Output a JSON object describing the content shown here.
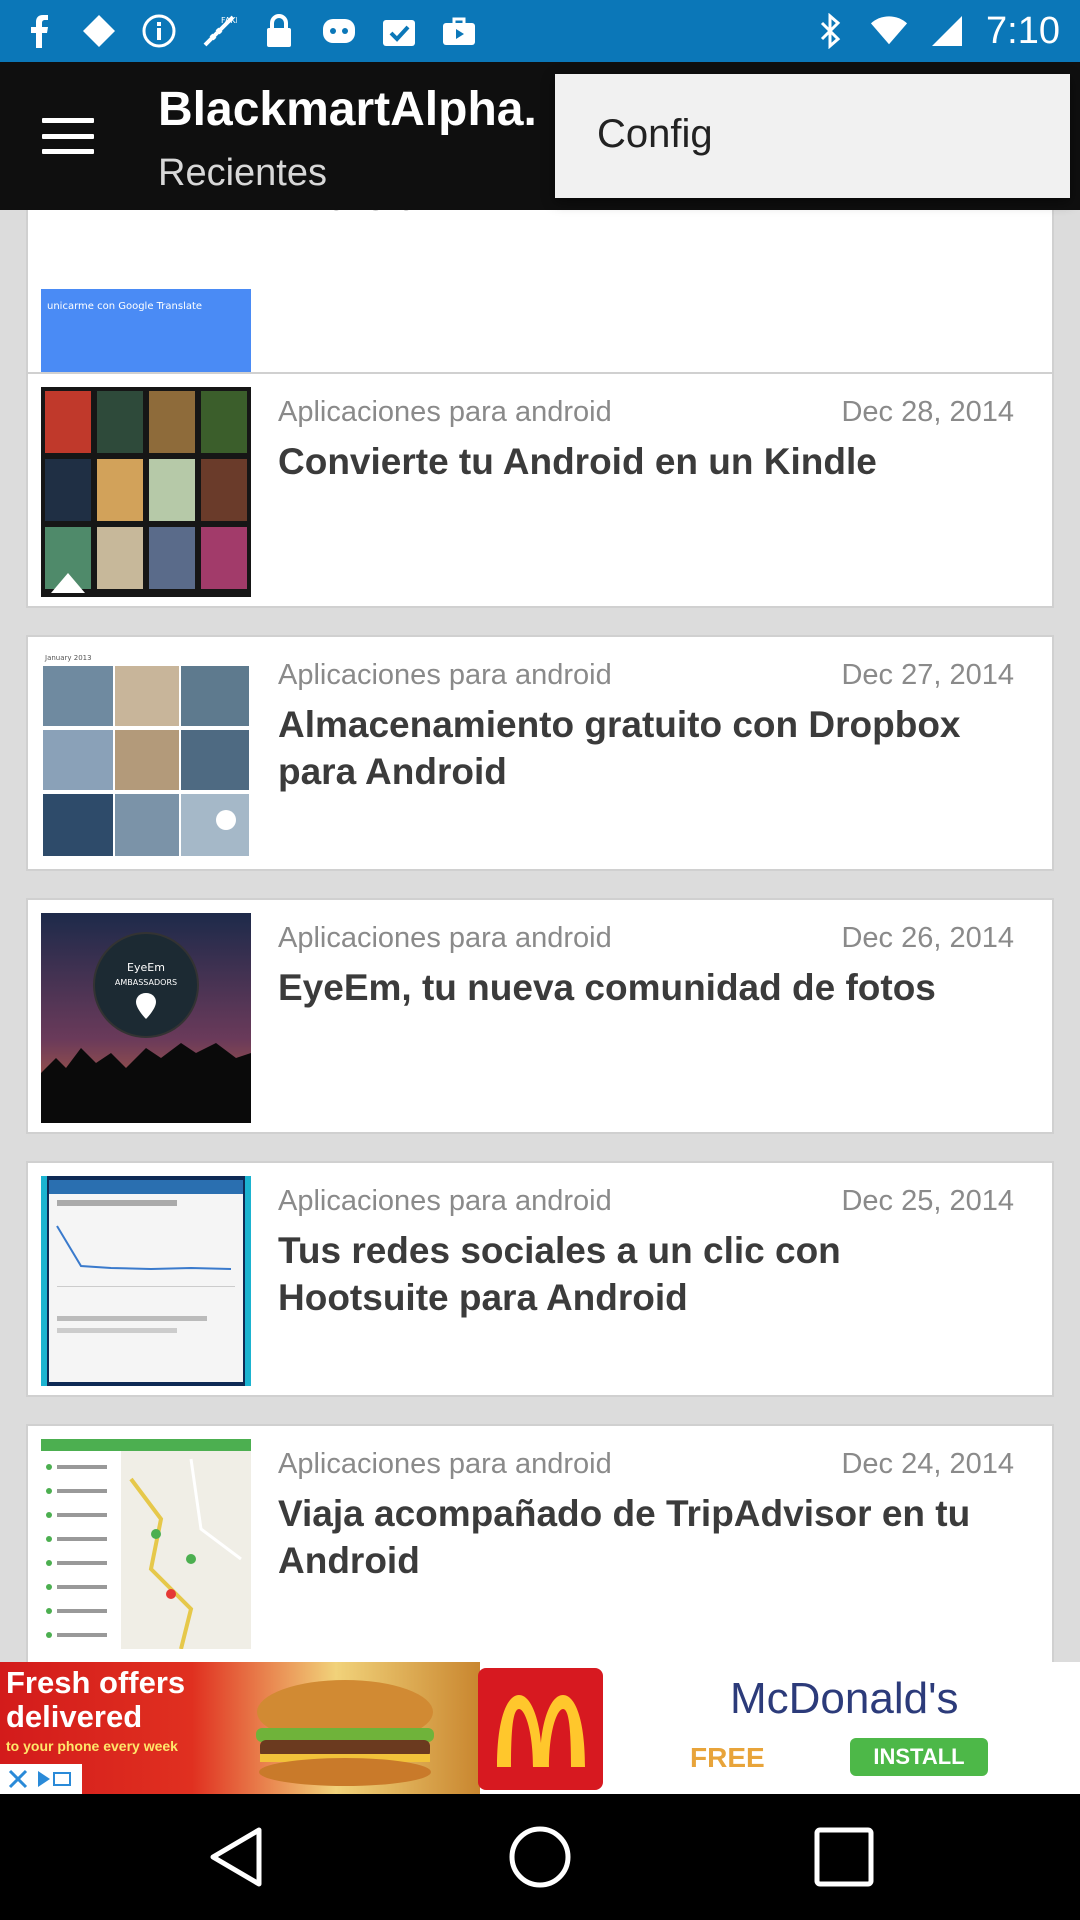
{
  "status_bar": {
    "time": "7:10",
    "icons": [
      "facebook-icon",
      "diamond-icon",
      "info-icon",
      "fake-gps-icon",
      "lock-icon",
      "notification-icon",
      "tasks-icon",
      "briefcase-icon",
      "bluetooth-icon",
      "wifi-icon",
      "signal-icon"
    ]
  },
  "app_bar": {
    "title": "BlackmartAlpha.",
    "subtitle": "Recientes"
  },
  "popup_menu": {
    "items": [
      {
        "label": "Config"
      }
    ]
  },
  "articles": [
    {
      "category": "",
      "date": "",
      "title": "Android"
    },
    {
      "category": "Aplicaciones para android",
      "date": "Dec 28, 2014",
      "title": "Convierte tu Android en un Kindle"
    },
    {
      "category": "Aplicaciones para android",
      "date": "Dec 27, 2014",
      "title": "Almacenamiento gratuito con Dropbox para Android"
    },
    {
      "category": "Aplicaciones para android",
      "date": "Dec 26, 2014",
      "title": "EyeEm, tu nueva comunidad de fotos"
    },
    {
      "category": "Aplicaciones para android",
      "date": "Dec 25, 2014",
      "title": "Tus redes sociales a un clic con Hootsuite para Android"
    },
    {
      "category": "Aplicaciones para android",
      "date": "Dec 24, 2014",
      "title": "Viaja acompañado de TripAdvisor en tu Android"
    }
  ],
  "thumbnails": {
    "translate_caption": "unicarme con Google Translate",
    "eyeem_caption_1": "EyeEm",
    "eyeem_caption_2": "AMBASSADORS",
    "dropbox_caption": "January 2013"
  },
  "ad": {
    "headline": "Fresh offers delivered",
    "sub": "to your phone every week",
    "brand": "McDonald's",
    "free_label": "FREE",
    "install_label": "INSTALL"
  },
  "colors": {
    "status_bar": "#0b77b8",
    "app_bar": "#0f0f0f",
    "list_bg": "#dcdcdc",
    "install_green": "#4db848",
    "mcd_red": "#d71920"
  }
}
